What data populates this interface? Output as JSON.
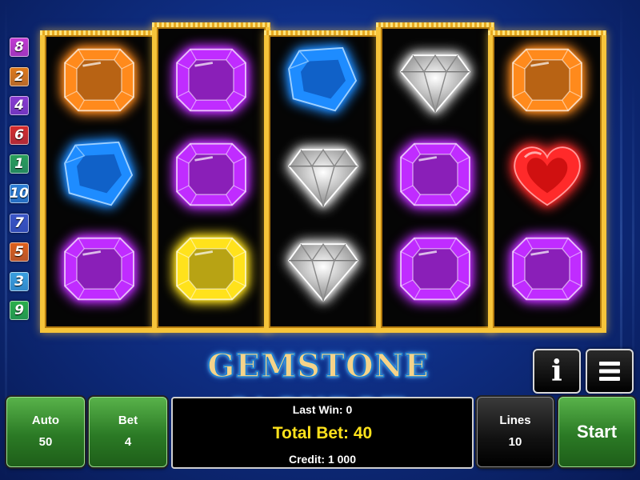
{
  "title": "GEMSTONE JACKPOT",
  "paylines": [
    {
      "number": "8",
      "color": "#c33ad2"
    },
    {
      "number": "2",
      "color": "#e07a1a"
    },
    {
      "number": "4",
      "color": "#8a3ad2"
    },
    {
      "number": "6",
      "color": "#d62b2b"
    },
    {
      "number": "1",
      "color": "#2aa05a"
    },
    {
      "number": "10",
      "color": "#2c7fd6"
    },
    {
      "number": "7",
      "color": "#3a55c8"
    },
    {
      "number": "5",
      "color": "#e0601a"
    },
    {
      "number": "3",
      "color": "#3aa0e0"
    },
    {
      "number": "9",
      "color": "#2ab04a"
    }
  ],
  "reels": [
    [
      "orange-gem",
      "blue-gem",
      "purple-gem"
    ],
    [
      "purple-gem",
      "purple-gem",
      "yellow-gem"
    ],
    [
      "blue-gem",
      "diamond",
      "diamond"
    ],
    [
      "diamond",
      "purple-gem",
      "purple-gem"
    ],
    [
      "orange-gem",
      "red-heart-gem",
      "purple-gem"
    ]
  ],
  "gem_colors": {
    "orange-gem": "#ff8a1c",
    "blue-gem": "#1e8cff",
    "purple-gem": "#c02cff",
    "yellow-gem": "#ffe21c",
    "diamond": "#e8e8e8",
    "red-heart-gem": "#ff2a2a"
  },
  "buttons": {
    "info_icon": "info-icon",
    "menu_icon": "menu-icon",
    "info_glyph": "i",
    "menu_glyph": "≡"
  },
  "panel": {
    "auto_label": "Auto",
    "auto_value": "50",
    "bet_label": "Bet",
    "bet_value": "4",
    "last_win": "Last Win: 0",
    "total_bet": "Total Bet: 40",
    "credit": "Credit: 1 000",
    "lines_label": "Lines",
    "lines_value": "10",
    "start_label": "Start"
  },
  "colors": {
    "gold_frame": "#f6c43a",
    "button_green": "#3a9a30",
    "total_bet_yellow": "#ffe21c"
  }
}
